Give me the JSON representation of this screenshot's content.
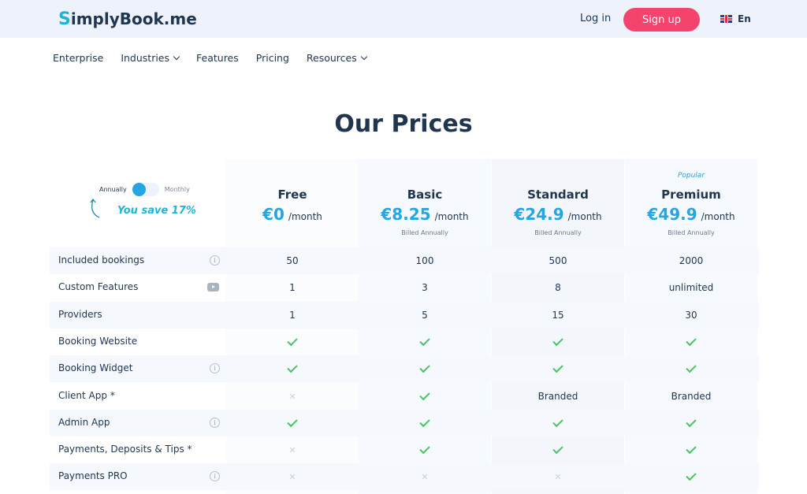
{
  "header": {
    "logo_s": "S",
    "logo_text": "implyBook",
    "logo_suffix": ".me",
    "login": "Log in",
    "signup": "Sign up",
    "language": "En"
  },
  "nav": {
    "items": [
      {
        "label": "Enterprise"
      },
      {
        "label": "Industries"
      },
      {
        "label": "Features"
      },
      {
        "label": "Pricing"
      },
      {
        "label": "Resources"
      }
    ]
  },
  "page_title": "Our Prices",
  "billing_toggle": {
    "annually": "Annually",
    "monthly": "Monthly",
    "save_text": "You save 17%"
  },
  "plans": [
    {
      "name": "Free",
      "price": "€0",
      "per": "/month",
      "billed": "",
      "popular": ""
    },
    {
      "name": "Basic",
      "price": "€8.25",
      "per": "/month",
      "billed": "Billed Annually",
      "popular": ""
    },
    {
      "name": "Standard",
      "price": "€24.9",
      "per": "/month",
      "billed": "Billed Annually",
      "popular": ""
    },
    {
      "name": "Premium",
      "price": "€49.9",
      "per": "/month",
      "billed": "Billed Annually",
      "popular": "Popular"
    }
  ],
  "features": [
    {
      "label": "Included bookings",
      "icon": "info-icon",
      "values": [
        "50",
        "100",
        "500",
        "2000"
      ]
    },
    {
      "label": "Custom Features",
      "icon": "video-icon",
      "values": [
        "1",
        "3",
        "8",
        "unlimited"
      ]
    },
    {
      "label": "Providers",
      "icon": "",
      "values": [
        "1",
        "5",
        "15",
        "30"
      ]
    },
    {
      "label": "Booking Website",
      "icon": "",
      "values": [
        "check",
        "check",
        "check",
        "check"
      ]
    },
    {
      "label": "Booking Widget",
      "icon": "info-icon",
      "values": [
        "check",
        "check",
        "check",
        "check"
      ]
    },
    {
      "label": "Client App *",
      "icon": "",
      "values": [
        "cross",
        "check",
        "Branded",
        "Branded"
      ]
    },
    {
      "label": "Admin App",
      "icon": "info-icon",
      "values": [
        "check",
        "check",
        "check",
        "check"
      ]
    },
    {
      "label": "Payments, Deposits & Tips *",
      "icon": "",
      "values": [
        "cross",
        "check",
        "check",
        "check"
      ]
    },
    {
      "label": "Payments PRO",
      "icon": "info-icon",
      "values": [
        "cross",
        "cross",
        "cross",
        "check"
      ]
    }
  ],
  "colors": {
    "accent": "#25a5e1",
    "signup": "#f4436c",
    "check": "#4bc463",
    "header_bg": "#eef3fb"
  }
}
